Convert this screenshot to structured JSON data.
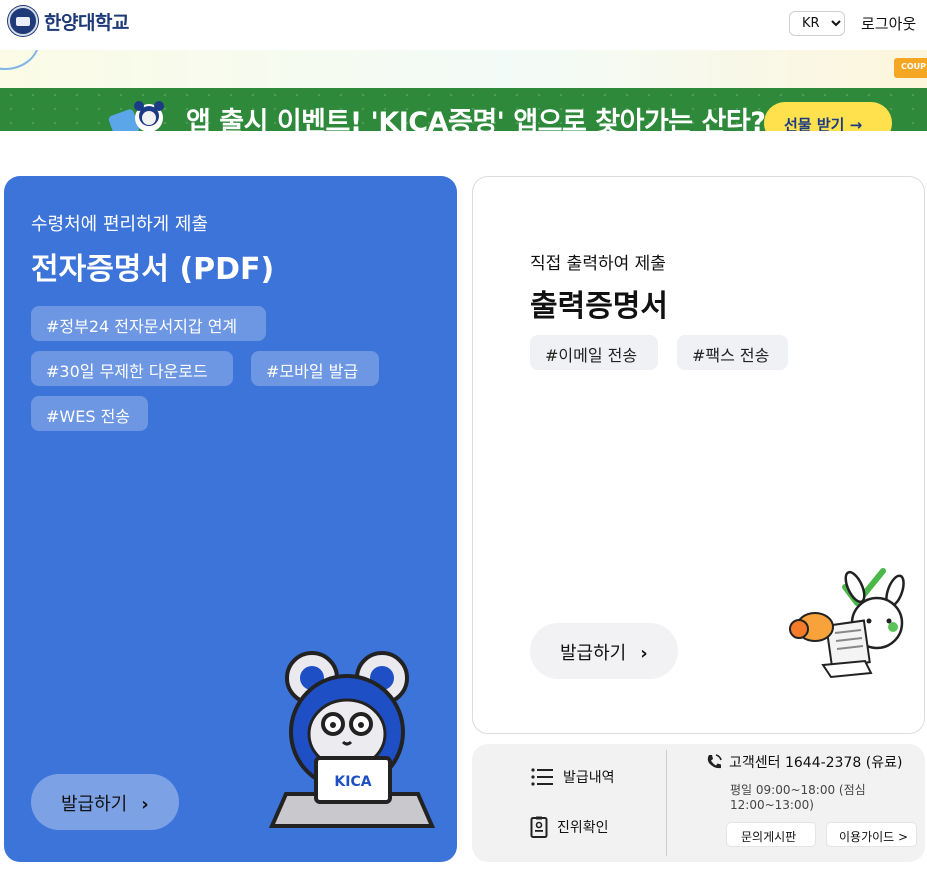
{
  "header": {
    "logo_text": "한양대학교",
    "language": {
      "selected": "KR",
      "options": [
        "KR"
      ]
    },
    "logout_label": "로그아웃"
  },
  "banner": {
    "coupon_text": "COUP",
    "text": "앱 출시 이벤트! 'KICA증명' 앱으로 찾아가는 산타?!",
    "button_label": "선물 받기 →"
  },
  "pdf_card": {
    "subtitle": "수령처에 편리하게 제출",
    "title": "전자증명서 (PDF)",
    "tags": [
      "#정부24 전자문서지갑 연계",
      "#30일 무제한 다운로드",
      "#모바일 발급",
      "#WES 전송"
    ],
    "button_label": "발급하기",
    "laptop_brand": "KICA"
  },
  "print_card": {
    "subtitle": "직접 출력하여 제출",
    "title": "출력증명서",
    "tags": [
      "#이메일 전송",
      "#팩스 전송"
    ],
    "button_label": "발급하기"
  },
  "service_panel": {
    "history_label": "발급내역",
    "verify_label": "진위확인",
    "customer_center": "고객센터 1644-2378 (유료)",
    "hours": "평일 09:00~18:00 (점심 12:00~13:00)",
    "board_button": "문의게시판",
    "guide_button": "이용가이드 >"
  },
  "colors": {
    "pdf_card": "#3d74d9",
    "banner_green": "#2e8a3a",
    "banner_button": "#ffe14d",
    "logo_navy": "#1e3a78"
  },
  "icons": [
    "university-seal-icon",
    "chevron-right-icon",
    "list-icon",
    "certificate-icon",
    "phone-icon"
  ]
}
